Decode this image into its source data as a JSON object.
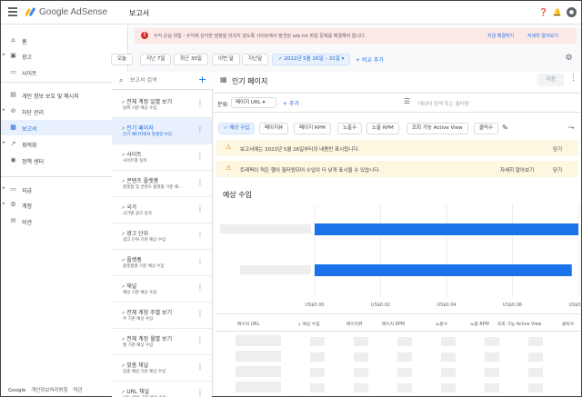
{
  "header": {
    "brand": "Google AdSense",
    "page_title": "보고서"
  },
  "nav": {
    "items": [
      {
        "label": "홈",
        "icon": "home-icon",
        "glyph": "⌂",
        "caret": false
      },
      {
        "label": "광고",
        "icon": "ads-icon",
        "glyph": "▣",
        "caret": true
      },
      {
        "label": "사이트",
        "icon": "sites-icon",
        "glyph": "▭",
        "caret": false
      },
      {
        "label": "개인 정보 보호 및 메시지",
        "icon": "privacy-icon",
        "glyph": "▤",
        "caret": false
      },
      {
        "label": "차단 관리",
        "icon": "block-icon",
        "glyph": "⊘",
        "caret": true
      },
      {
        "label": "보고서",
        "icon": "reports-icon",
        "glyph": "▦",
        "caret": false,
        "active": true
      },
      {
        "label": "최적화",
        "icon": "optimize-icon",
        "glyph": "↗",
        "caret": true
      },
      {
        "label": "정책 센터",
        "icon": "policy-icon",
        "glyph": "◉",
        "caret": false
      },
      {
        "label": "지급",
        "icon": "payments-icon",
        "glyph": "▭",
        "caret": true
      },
      {
        "label": "계정",
        "icon": "account-icon",
        "glyph": "⚙",
        "caret": true
      },
      {
        "label": "의견",
        "icon": "feedback-icon",
        "glyph": "✉",
        "caret": false
      }
    ],
    "footer": {
      "google": "Google",
      "privacy": "개인정보처리방침",
      "terms": "약관"
    }
  },
  "alert": {
    "text": "수익 손실 위험 - 수익에 심각한 영향을 미치지 않도록 사이트에서 발견된 ads.txt 파일 문제를 해결해야 합니다.",
    "action_fix": "지금 해결하기",
    "action_learn": "자세히 알아보기"
  },
  "date_chips": [
    "오늘",
    "지난 7일",
    "최근 30일",
    "이번 달",
    "지난달"
  ],
  "date_range": "2022년 5월 26일 – 31일",
  "add_compare": "비교 추가",
  "report_list": {
    "search_placeholder": "보고서 검색",
    "items": [
      {
        "title": "전체 계정 일별 보기",
        "subtitle": "날짜 기준 예상 수입"
      },
      {
        "title": "인기 페이지",
        "subtitle": "인기 페이지에서 발생한 수입",
        "active": true
      },
      {
        "title": "사이트",
        "subtitle": "사이트별 실적"
      },
      {
        "title": "콘텐츠 플랫폼",
        "subtitle": "플랫폼 및 콘텐츠 플랫폼 기준 예..."
      },
      {
        "title": "국가",
        "subtitle": "국가별 광고 실적"
      },
      {
        "title": "광고 단위",
        "subtitle": "광고 단위 기준 예상 수입"
      },
      {
        "title": "플랫폼",
        "subtitle": "플랫폼별 기준 예상 수입"
      },
      {
        "title": "채널",
        "subtitle": "채널 기준 예상 수입"
      },
      {
        "title": "전체 계정 주별 보기",
        "subtitle": "주 기준 예상 수입"
      },
      {
        "title": "전체 계정 월별 보기",
        "subtitle": "월 기준 예상 수입"
      },
      {
        "title": "맞춤 채널",
        "subtitle": "맞춤 채널 기준 예상 수입"
      },
      {
        "title": "URL 채널",
        "subtitle": "URL 채널 기준 예상 수입"
      }
    ]
  },
  "report": {
    "title": "인기 페이지",
    "save": "저장",
    "breakdown_label": "분류:",
    "breakdown_value": "페이지 URL",
    "add": "추가",
    "filter_placeholder": "데이터 검색 또는 필터링",
    "metric_chips": [
      "예상 수입",
      "페이지뷰",
      "페이지 RPM",
      "노출수",
      "노출 RPM",
      "조회 가능 Active View",
      "클릭수"
    ],
    "warnings": [
      {
        "text": "보고서에는 2022년 5월 26일부터의 내용만 표시됩니다.",
        "actions": [
          "닫기"
        ]
      },
      {
        "text": "트래픽이 적은 행이 필터링되어 수입이 더 낮게 표시될 수 있습니다.",
        "actions": [
          "자세히 알아보기",
          "닫기"
        ]
      }
    ],
    "chart_title": "예상 수입"
  },
  "chart_data": {
    "type": "bar",
    "orientation": "horizontal",
    "title": "예상 수입",
    "categories": [
      "",
      ""
    ],
    "values": [
      0.085,
      0.078
    ],
    "xlim": [
      0,
      0.08
    ],
    "x_ticks": [
      "US$0.00",
      "US$0.02",
      "US$0.04",
      "US$0.06",
      "US$0.08"
    ],
    "bar_color": "#1a73e8"
  },
  "table": {
    "headers": [
      "페이지 URL",
      "예상 수입",
      "페이지뷰",
      "페이지 RPM",
      "노출수",
      "노출 RPM",
      "조회 가능 Active View",
      "클릭수"
    ]
  }
}
